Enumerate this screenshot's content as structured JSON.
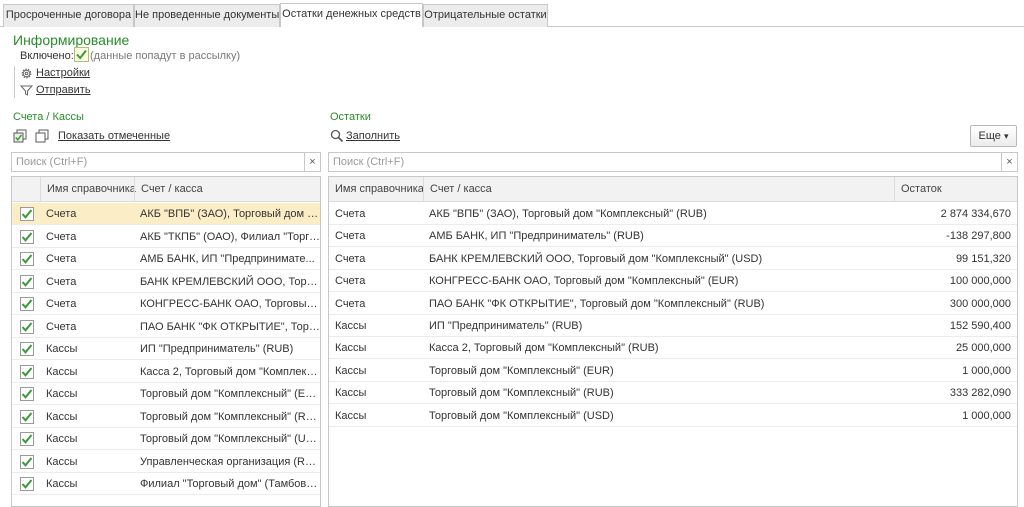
{
  "tabs": [
    {
      "label": "Просроченные договора",
      "active": false
    },
    {
      "label": "Не проведенные документы",
      "active": false
    },
    {
      "label": "Остатки денежных средств",
      "active": true
    },
    {
      "label": "Отрицательные остатки",
      "active": false
    }
  ],
  "informing": {
    "title": "Информирование",
    "enabled_label": "Включено:",
    "enabled_checked": true,
    "enabled_note": "(данные попадут в рассылку)",
    "settings_link": "Настройки",
    "send_link": "Отправить"
  },
  "accounts": {
    "title": "Счета / Кассы",
    "show_marked_link": "Показать отмеченные",
    "search_placeholder": "Поиск (Ctrl+F)",
    "clear_symbol": "×",
    "columns": [
      "Имя справочника",
      "Счет / касса"
    ],
    "rows": [
      {
        "checked": true,
        "type": "Счета",
        "account": "АКБ \"ВПБ\" (ЗАО), Торговый дом \"..."
      },
      {
        "checked": true,
        "type": "Счета",
        "account": "АКБ \"ТКПБ\" (ОАО), Филиал \"Торго..."
      },
      {
        "checked": true,
        "type": "Счета",
        "account": "АМБ БАНК, ИП \"Предпринимате..."
      },
      {
        "checked": true,
        "type": "Счета",
        "account": "БАНК КРЕМЛЕВСКИЙ ООО, Торго..."
      },
      {
        "checked": true,
        "type": "Счета",
        "account": "КОНГРЕСС-БАНК ОАО, Торговый ..."
      },
      {
        "checked": true,
        "type": "Счета",
        "account": "ПАО БАНК \"ФК ОТКРЫТИЕ\", Торг..."
      },
      {
        "checked": true,
        "type": "Кассы",
        "account": "ИП \"Предприниматель\" (RUB)"
      },
      {
        "checked": true,
        "type": "Кассы",
        "account": "Касса 2, Торговый дом \"Комплекс..."
      },
      {
        "checked": true,
        "type": "Кассы",
        "account": "Торговый дом \"Комплексный\" (EUR)"
      },
      {
        "checked": true,
        "type": "Кассы",
        "account": "Торговый дом \"Комплексный\" (RUB)"
      },
      {
        "checked": true,
        "type": "Кассы",
        "account": "Торговый дом \"Комплексный\" (USD)"
      },
      {
        "checked": true,
        "type": "Кассы",
        "account": "Управленческая организация (RUB)"
      },
      {
        "checked": true,
        "type": "Кассы",
        "account": "Филиал \"Торговый дом\" (Тамбов) (..."
      }
    ]
  },
  "balances": {
    "title": "Остатки",
    "fill_link": "Заполнить",
    "more_label": "Еще",
    "more_arrow": "▾",
    "search_placeholder": "Поиск (Ctrl+F)",
    "clear_symbol": "×",
    "columns": [
      "Имя справочника",
      "Счет / касса",
      "Остаток"
    ],
    "rows": [
      {
        "type": "Счета",
        "account": "АКБ \"ВПБ\" (ЗАО), Торговый дом \"Комплексный\" (RUB)",
        "amount": "2 874 334,670"
      },
      {
        "type": "Счета",
        "account": "АМБ БАНК, ИП \"Предприниматель\" (RUB)",
        "amount": "-138 297,800"
      },
      {
        "type": "Счета",
        "account": "БАНК КРЕМЛЕВСКИЙ ООО, Торговый дом \"Комплексный\" (USD)",
        "amount": "99 151,320"
      },
      {
        "type": "Счета",
        "account": "КОНГРЕСС-БАНК ОАО, Торговый дом \"Комплексный\" (EUR)",
        "amount": "100 000,000"
      },
      {
        "type": "Счета",
        "account": "ПАО БАНК \"ФК ОТКРЫТИЕ\", Торговый дом \"Комплексный\" (RUB)",
        "amount": "300 000,000"
      },
      {
        "type": "Кассы",
        "account": "ИП \"Предприниматель\" (RUB)",
        "amount": "152 590,400"
      },
      {
        "type": "Кассы",
        "account": "Касса 2, Торговый дом \"Комплексный\" (RUB)",
        "amount": "25 000,000"
      },
      {
        "type": "Кассы",
        "account": "Торговый дом \"Комплексный\" (EUR)",
        "amount": "1 000,000"
      },
      {
        "type": "Кассы",
        "account": "Торговый дом \"Комплексный\" (RUB)",
        "amount": "333 282,090"
      },
      {
        "type": "Кассы",
        "account": "Торговый дом \"Комплексный\" (USD)",
        "amount": "1 000,000"
      }
    ]
  },
  "colors": {
    "accent_green": "#2a8c2a",
    "selected_row": "#fbeec6",
    "check_green": "#3a9a3a"
  }
}
